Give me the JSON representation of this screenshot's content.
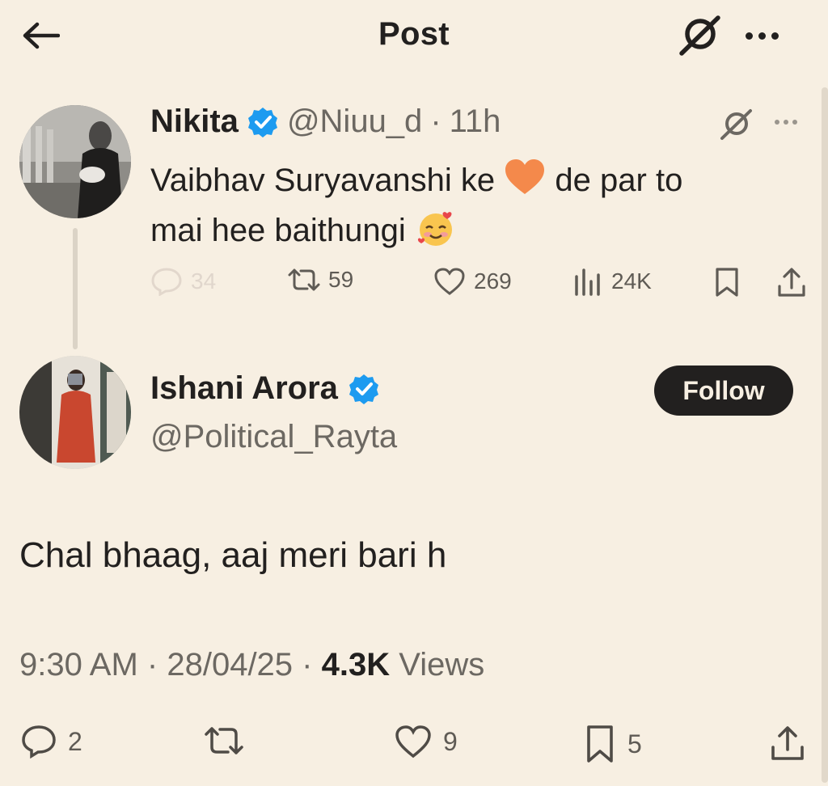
{
  "header": {
    "title": "Post"
  },
  "parent_tweet": {
    "name": "Nikita",
    "handle": "@Niuu_d",
    "separator": "·",
    "time": "11h",
    "text_line1_a": "Vaibhav Suryavanshi ke ",
    "text_line1_b": "de par to",
    "text_line2": "mai hee baithungi ",
    "emoji_1": "orange-heart",
    "emoji_2": "smiling-face-with-hearts",
    "stats": {
      "replies": "34",
      "reposts": "59",
      "likes": "269",
      "views": "24K"
    }
  },
  "main_tweet": {
    "name": "Ishani Arora",
    "handle": "@Political_Rayta",
    "follow_label": "Follow",
    "text": "Chal bhaag, aaj meri bari h",
    "time": "9:30 AM",
    "sep": "·",
    "date": "28/04/25",
    "views_count": "4.3K",
    "views_label": "Views",
    "stats": {
      "replies": "2",
      "likes": "9",
      "bookmarks": "5"
    }
  },
  "colors": {
    "background": "#f7efe2",
    "text": "#22201f",
    "muted": "#6c6862",
    "verified": "#1d9bf0",
    "heart_orange": "#f4894b"
  }
}
